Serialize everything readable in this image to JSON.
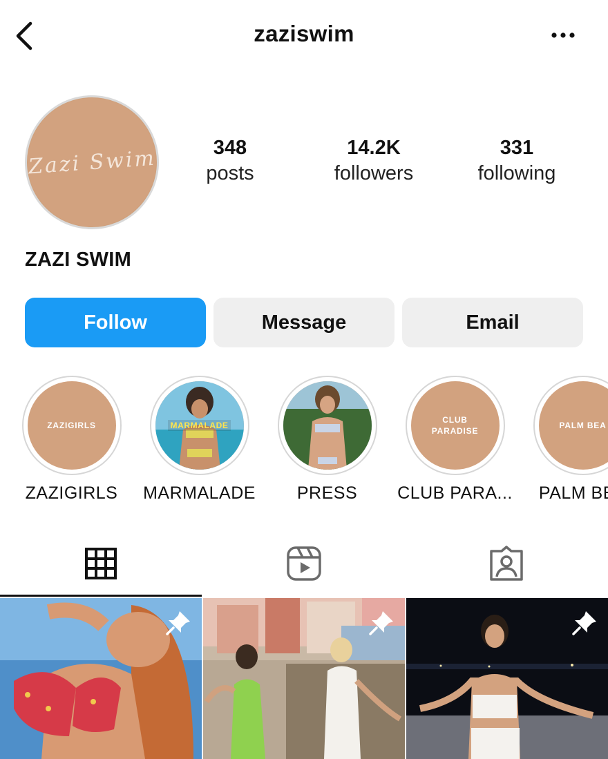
{
  "header": {
    "username": "zaziswim",
    "back_icon": "chevron-left-icon",
    "more_icon": "more-horizontal-icon"
  },
  "profile": {
    "display_name": "ZAZI SWIM",
    "avatar_text": "Zazi Swim",
    "stats": [
      {
        "value": "348",
        "label": "posts"
      },
      {
        "value": "14.2K",
        "label": "followers"
      },
      {
        "value": "331",
        "label": "following"
      }
    ]
  },
  "actions": {
    "follow": "Follow",
    "message": "Message",
    "email": "Email"
  },
  "highlights": [
    {
      "label": "ZAZIGIRLS",
      "cover_text": "ZAZIGIRLS"
    },
    {
      "label": "MARMALADE",
      "cover_text": "MARMALADE"
    },
    {
      "label": "PRESS",
      "cover_text": ""
    },
    {
      "label": "CLUB PARA...",
      "cover_text": "CLUB\nPARADISE"
    },
    {
      "label": "PALM BEA",
      "cover_text": "PALM BEA"
    }
  ],
  "tabs": [
    {
      "name": "grid",
      "icon": "grid-icon",
      "active": true
    },
    {
      "name": "reels",
      "icon": "reels-icon",
      "active": false
    },
    {
      "name": "tagged",
      "icon": "tagged-person-icon",
      "active": false
    }
  ],
  "posts": [
    {
      "pinned": true,
      "icon": "pin-icon"
    },
    {
      "pinned": true,
      "icon": "pin-icon"
    },
    {
      "pinned": true,
      "icon": "pin-icon"
    }
  ],
  "colors": {
    "brand_tan": "#d2a27f",
    "follow_blue": "#1a9bf5",
    "button_gray": "#efefef"
  }
}
